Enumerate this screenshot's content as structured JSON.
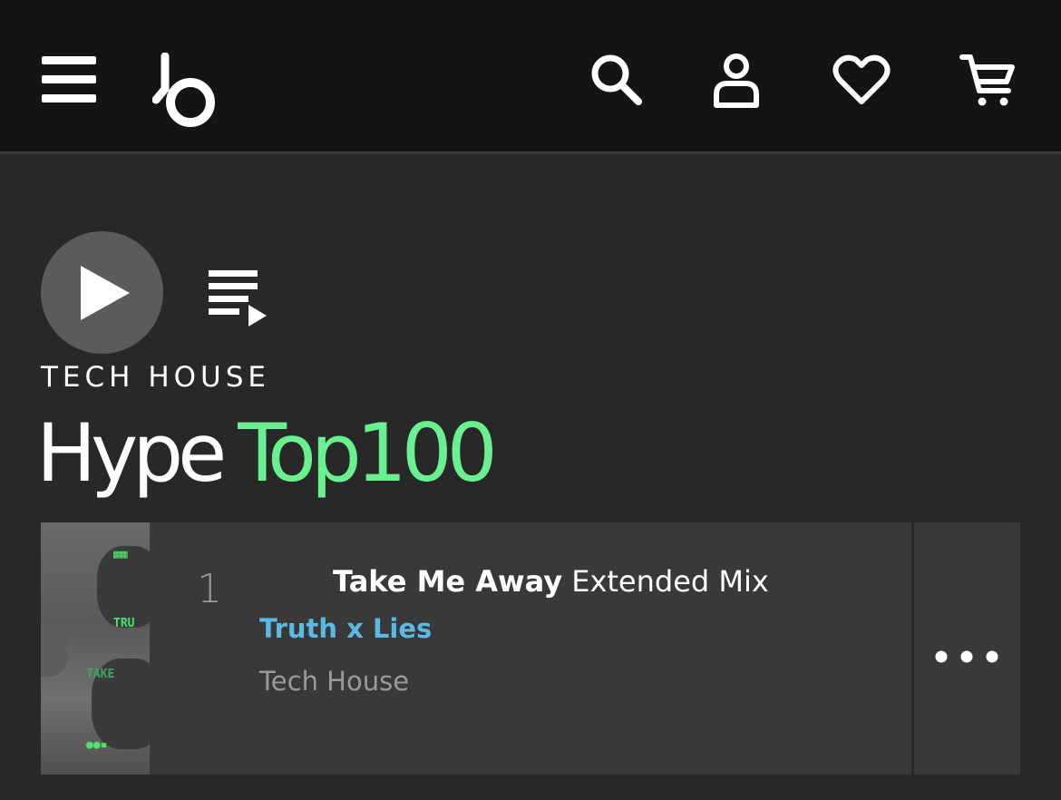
{
  "header": {
    "menu_icon": "hamburger-menu-icon",
    "logo": "beatport-logo",
    "actions": [
      "search-icon",
      "user-icon",
      "heart-icon",
      "cart-icon"
    ]
  },
  "controls": {
    "play_icon": "play-icon",
    "queue_icon": "add-to-queue-icon"
  },
  "chart": {
    "genre": "TECH HOUSE",
    "title_part1": "Hype",
    "title_part2": "Top100"
  },
  "tracks": [
    {
      "rank": "1",
      "title": "Take Me Away",
      "mix": "Extended Mix",
      "artist": "Truth x Lies",
      "genre": "Tech House"
    }
  ],
  "colors": {
    "accent_green": "#69f090",
    "artist_blue": "#5bb9e6",
    "header_bg": "#141414",
    "page_bg": "#282828",
    "card_bg": "#393939"
  }
}
